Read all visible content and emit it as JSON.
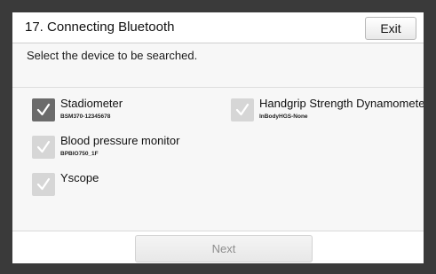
{
  "header": {
    "title": "17. Connecting Bluetooth",
    "exit_label": "Exit"
  },
  "instruction": "Select the device to be searched.",
  "devices": [
    {
      "name": "Stadiometer",
      "id": "BSM370-12345678",
      "checked": true
    },
    {
      "name": "Handgrip Strength Dynamometer",
      "id": "InBodyHGS-None",
      "checked": false
    },
    {
      "name": "Blood pressure monitor",
      "id": "BPBIO750_1F",
      "checked": false
    },
    {
      "name": "Yscope",
      "id": "",
      "checked": false
    }
  ],
  "footer": {
    "next_label": "Next"
  },
  "colors": {
    "checked_box": "#6b6b6b",
    "unchecked_box": "#d6d6d6",
    "disabled_text": "#8e8e8e"
  },
  "icons": {
    "checkbox": "checkmark-icon"
  }
}
